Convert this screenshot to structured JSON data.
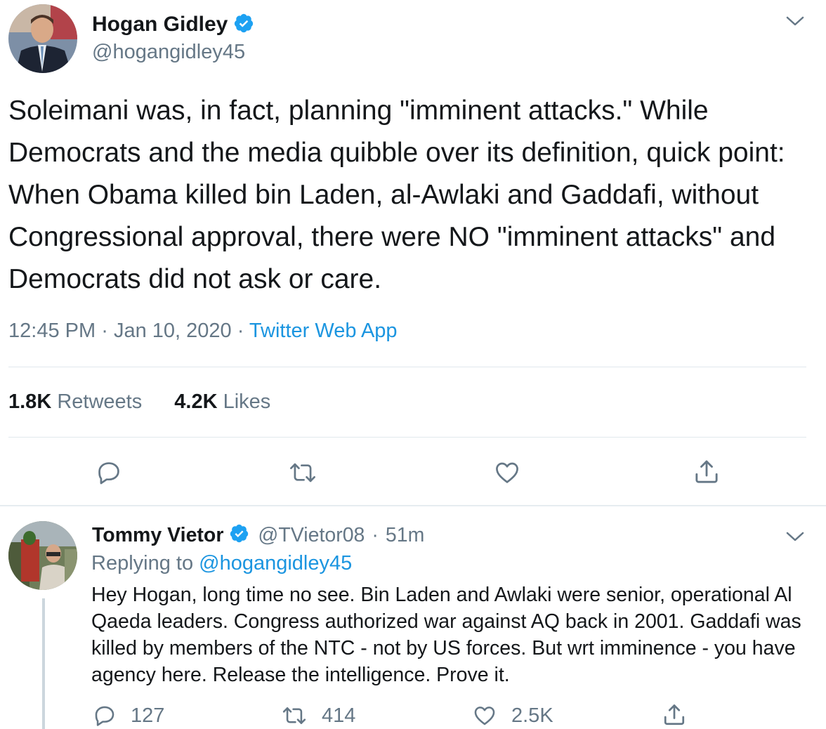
{
  "main_tweet": {
    "author_name": "Hogan Gidley",
    "author_handle": "@hogangidley45",
    "text": "Soleimani was, in fact, planning \"imminent attacks.\" While Democrats and the media quibble over its definition, quick point: When Obama killed bin Laden, al-Awlaki and Gaddafi, without Congressional approval, there were NO \"imminent attacks\" and Democrats did not ask or care.",
    "time": "12:45 PM",
    "date": "Jan 10, 2020",
    "separator": "·",
    "source": "Twitter Web App",
    "retweets_count": "1.8K",
    "retweets_label": "Retweets",
    "likes_count": "4.2K",
    "likes_label": "Likes"
  },
  "reply_tweet": {
    "author_name": "Tommy Vietor",
    "author_handle": "@TVietor08",
    "separator": "·",
    "time_ago": "51m",
    "replying_prefix": "Replying to",
    "replying_to": "@hogangidley45",
    "text": "Hey Hogan, long time no see. Bin Laden and Awlaki were senior, operational Al Qaeda leaders. Congress authorized war against AQ back in 2001. Gaddafi was killed by members of the NTC - not by US forces. But wrt imminence - you have agency here. Release the intelligence. Prove it.",
    "replies_count": "127",
    "retweets_count": "414",
    "likes_count": "2.5K"
  },
  "icons": {
    "verified": "verified-badge-icon",
    "chevron": "chevron-down-icon",
    "reply": "reply-icon",
    "retweet": "retweet-icon",
    "like": "heart-icon",
    "share": "share-icon"
  },
  "colors": {
    "text": "#14171a",
    "secondary": "#657786",
    "link": "#1b95e0",
    "verified": "#1da1f2",
    "divider": "#e1e8ed"
  }
}
